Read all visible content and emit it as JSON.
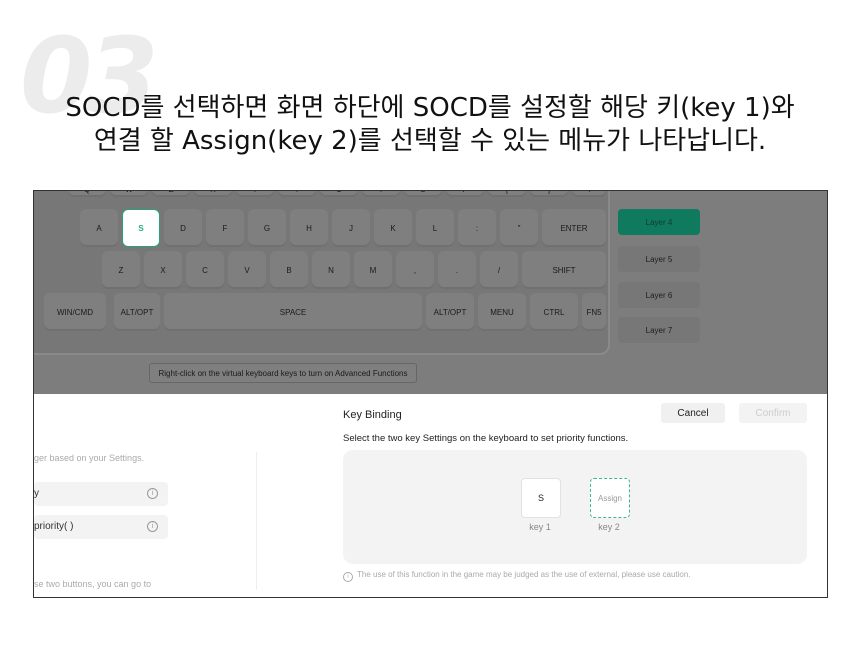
{
  "step_number": "03",
  "heading": {
    "line1": "SOCD를 선택하면 화면 하단에 SOCD를 설정할 해당 키(key 1)와",
    "line2": "연결 할 Assign(key 2)를 선택할 수 있는 메뉴가 나타납니다."
  },
  "keyboard": {
    "row0": [
      "Q",
      "W",
      "E",
      "R",
      "T",
      "Y",
      "U",
      "I",
      "O",
      "P",
      "[",
      "]",
      "\\"
    ],
    "row1": [
      "A",
      "S",
      "D",
      "F",
      "G",
      "H",
      "J",
      "K",
      "L",
      ":",
      "\"",
      "ENTER"
    ],
    "row2": [
      "Z",
      "X",
      "C",
      "V",
      "B",
      "N",
      "M",
      ",",
      ".",
      "/",
      "SHIFT"
    ],
    "row3": [
      "WIN/CMD",
      "ALT/OPT",
      "SPACE",
      "ALT/OPT",
      "MENU",
      "CTRL",
      "FN5"
    ],
    "selected_key": "S"
  },
  "layers": [
    "Layer 4",
    "Layer 5",
    "Layer 6",
    "Layer 7"
  ],
  "active_layer": "Layer 4",
  "hint": "Right-click on the virtual keyboard keys to turn on Advanced Functions",
  "left_panel": {
    "text1": "ger based on your Settings.",
    "option1": "y",
    "option2": "priority( )",
    "text2": "se two buttons, you can go to"
  },
  "key_binding": {
    "title": "Key Binding",
    "cancel": "Cancel",
    "confirm": "Confirm",
    "description": "Select the two key Settings on the keyboard to set priority functions.",
    "key1_value": "S",
    "key2_value": "Assign",
    "key1_label": "key 1",
    "key2_label": "key 2",
    "note": "The use of this function in the game may be judged as the use of external, please use caution."
  },
  "colors": {
    "accent": "#1fae85",
    "overlay": "#7d7d7d",
    "active_layer": "#0f7a5e"
  }
}
